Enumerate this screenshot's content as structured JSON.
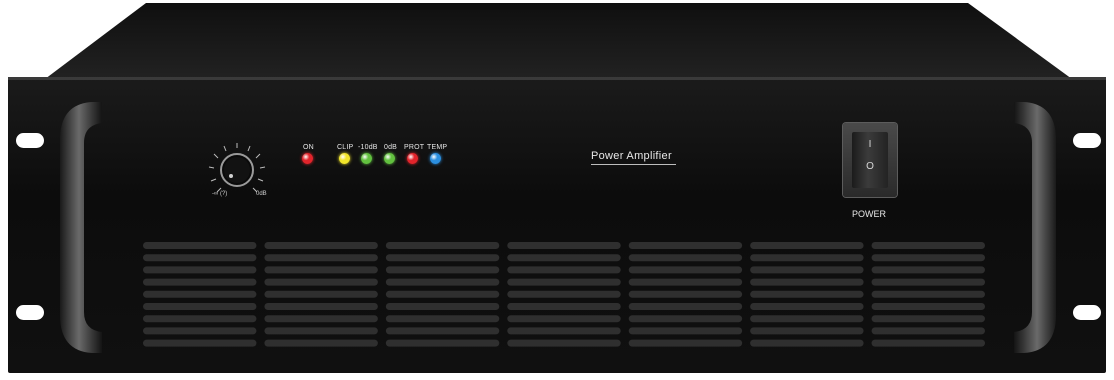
{
  "device": {
    "brand_text": "Power Amplifier",
    "power_label": "POWER",
    "switch_on_mark": "I",
    "switch_off_mark": "O"
  },
  "knob": {
    "min_label": "-∞ (?)",
    "max_label": "0dB"
  },
  "indicators": [
    {
      "label": "ON",
      "color": "#e2242b"
    },
    {
      "label": "CLIP",
      "color": "#f2e52a"
    },
    {
      "label": "-10dB",
      "color": "#62c13f"
    },
    {
      "label": "0dB",
      "color": "#62c13f"
    },
    {
      "label": "PROT",
      "color": "#e2242b"
    },
    {
      "label": "TEMP",
      "color": "#2b8fe0"
    }
  ],
  "colors": {
    "panel": "#111111",
    "cover": "#1a1a1a"
  }
}
